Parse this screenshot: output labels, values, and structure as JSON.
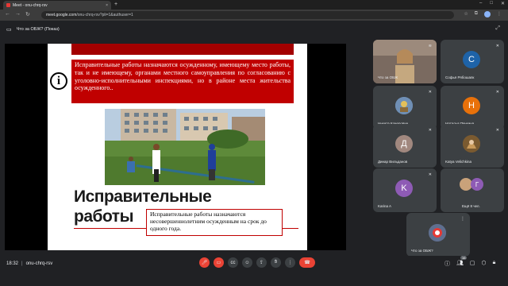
{
  "browser": {
    "tab_title": "Meet - onu-chrq-rsv",
    "tab_close": "×",
    "new_tab": "+",
    "url_domain": "meet.google.com",
    "url_path": "/onu-chrq-rsv?pli=1&authuser=1"
  },
  "presentation": {
    "label": "Что за ОБЖ? (Показ)"
  },
  "slide": {
    "info_text": "Исправительные работы назначаются осужденному, имеющему место работы, так и не имеющему, органами местного самоуправления по согласованию с уголовно-исполнительными инспекциями, но в районе места жительства осужденного..",
    "info_glyph": "i",
    "title": "Исправительные работы",
    "note": "Исправительные работы назначаются несовершеннолетним осужденным на срок до одного года."
  },
  "participants": [
    {
      "name": "Что за ОБЖ",
      "type": "video"
    },
    {
      "name": "Софья Рябошапк",
      "initial": "С",
      "color": "#1e63a8"
    },
    {
      "name": "Никита Кочерович",
      "type": "avatar-img"
    },
    {
      "name": "Наталья Печкина",
      "initial": "Н",
      "color": "#e8710a"
    },
    {
      "name": "Динар Вильданов",
      "initial": "Д",
      "color": "#a1887f"
    },
    {
      "name": "Katya Velichkina",
      "type": "avatar-img"
    },
    {
      "name": "Karina A",
      "initial": "K",
      "color": "#8e5bb5"
    },
    {
      "name": "Ещё 8 чел.",
      "initial": "Г",
      "color": "#8e5bb5"
    },
    {
      "name": "Что за ОБЖ?",
      "type": "avatar-img"
    }
  ],
  "bottom": {
    "time": "18:32",
    "meeting_code": "onu-chrq-rsv",
    "participant_count": "16"
  }
}
